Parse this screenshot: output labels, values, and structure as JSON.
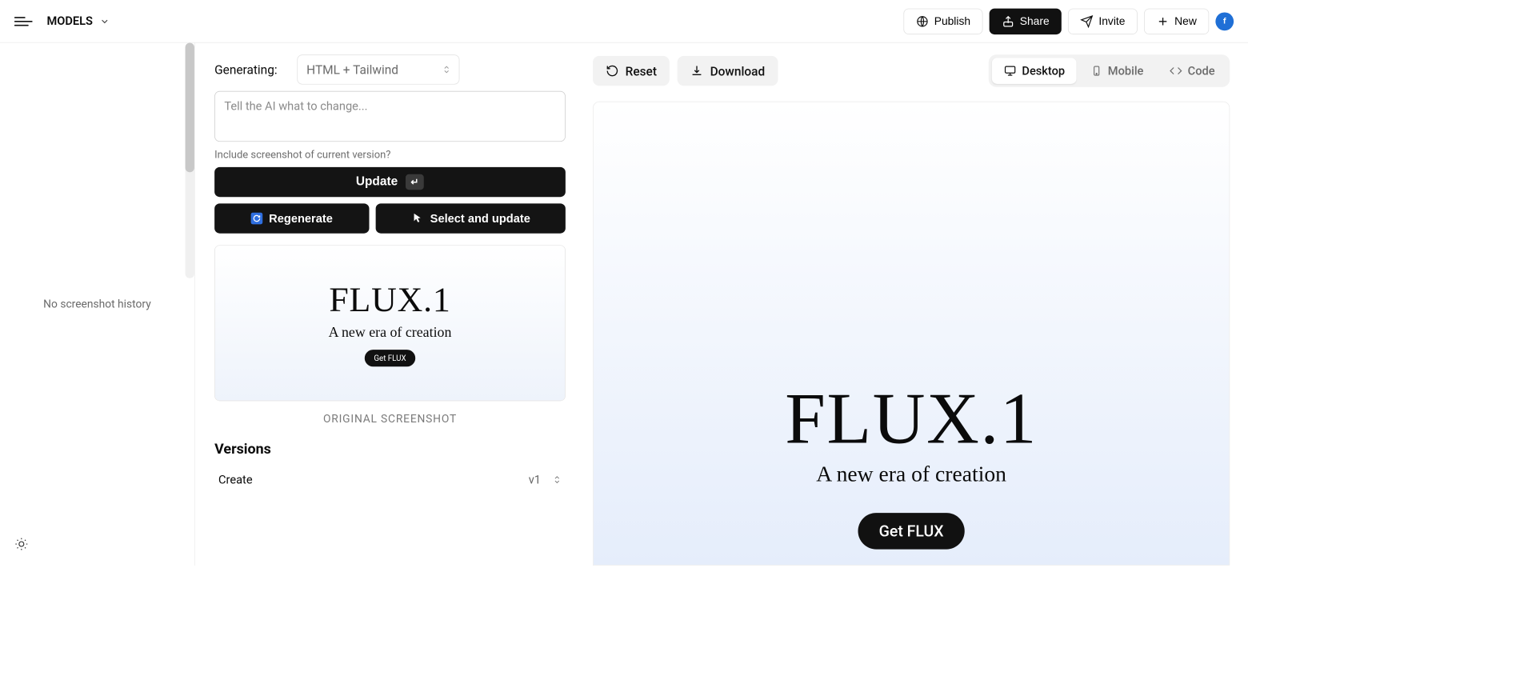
{
  "topbar": {
    "project_name": "MODELS",
    "publish": "Publish",
    "share": "Share",
    "invite": "Invite",
    "new": "New",
    "avatar_initial": "f"
  },
  "history": {
    "empty_text": "No screenshot history"
  },
  "editor": {
    "generating_label": "Generating:",
    "framework_selected": "HTML + Tailwind",
    "prompt_placeholder": "Tell the AI what to change...",
    "screenshot_hint": "Include screenshot of current version?",
    "update_label": "Update",
    "update_key": "↵",
    "regenerate_label": "Regenerate",
    "select_update_label": "Select and update",
    "original_caption": "ORIGINAL SCREENSHOT",
    "versions_heading": "Versions",
    "version_row": {
      "label": "Create",
      "tag": "v1"
    }
  },
  "preview": {
    "reset": "Reset",
    "download": "Download",
    "tabs": {
      "desktop": "Desktop",
      "mobile": "Mobile",
      "code": "Code"
    },
    "hero_title": "FLUX.1",
    "hero_sub": "A new era of creation",
    "hero_cta": "Get FLUX"
  },
  "thumb": {
    "title": "FLUX.1",
    "sub": "A new era of creation",
    "cta": "Get FLUX"
  }
}
